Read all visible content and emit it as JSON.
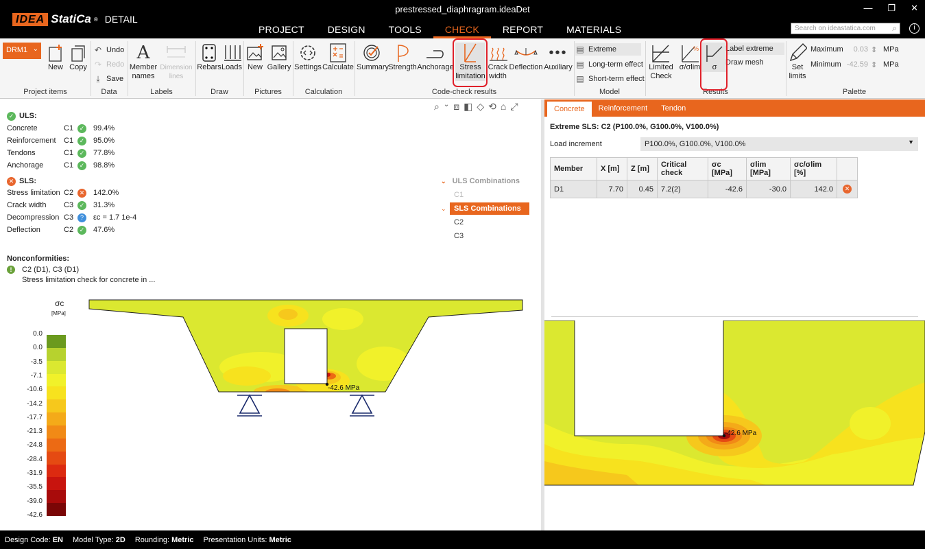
{
  "window": {
    "title": "prestressed_diaphragram.ideaDet",
    "logo_idea": "IDEA",
    "logo_statica": "StatiCa",
    "logo_reg": "®",
    "logo_product": "DETAIL",
    "controls": [
      "—",
      "❐",
      "✕"
    ]
  },
  "main_menu": [
    "PROJECT",
    "DESIGN",
    "TOOLS",
    "CHECK",
    "REPORT",
    "MATERIALS"
  ],
  "search": {
    "placeholder": "Search on ideastatica.com"
  },
  "ribbon": {
    "groups": {
      "project_items": "Project items",
      "data": "Data",
      "labels": "Labels",
      "draw": "Draw",
      "pictures": "Pictures",
      "calculation": "Calculation",
      "code_check": "Code-check results",
      "model": "Model",
      "results": "Results",
      "palette": "Palette"
    },
    "drm": "DRM1",
    "new": "New",
    "copy": "Copy",
    "undo": "Undo",
    "redo": "Redo",
    "save": "Save",
    "member_names_1": "Member",
    "member_names_2": "names",
    "dimension_lines_1": "Dimension",
    "dimension_lines_2": "lines",
    "rebars": "Rebars",
    "loads": "Loads",
    "pic_new": "New",
    "gallery": "Gallery",
    "settings": "Settings",
    "calculate": "Calculate",
    "summary": "Summary",
    "strength": "Strength",
    "anchorage": "Anchorage",
    "stress_1": "Stress",
    "stress_2": "limitation",
    "crack_1": "Crack",
    "crack_2": "width",
    "deflection": "Deflection",
    "auxiliary": "Auxiliary",
    "extreme": "Extreme",
    "long_term": "Long-term effect",
    "short_term": "Short-term effect",
    "limited_1": "Limited",
    "limited_2": "Check",
    "sigma_ratio": "σ/σlim",
    "sigma": "σ",
    "label_extreme": "Label extreme",
    "draw_mesh": "Draw mesh",
    "set_limits_1": "Set",
    "set_limits_2": "limits",
    "maximum": "Maximum",
    "minimum": "Minimum",
    "max_val": "0.03",
    "min_val": "-42.59",
    "unit": "MPa"
  },
  "summary": {
    "uls": "ULS:",
    "uls_rows": [
      {
        "name": "Concrete",
        "combo": "C1",
        "value": "99.4%"
      },
      {
        "name": "Reinforcement",
        "combo": "C1",
        "value": "95.0%"
      },
      {
        "name": "Tendons",
        "combo": "C1",
        "value": "77.8%"
      },
      {
        "name": "Anchorage",
        "combo": "C1",
        "value": "98.8%"
      }
    ],
    "sls": "SLS:",
    "sls_rows": [
      {
        "name": "Stress limitation",
        "combo": "C2",
        "value": "142.0%",
        "status": "bad"
      },
      {
        "name": "Crack width",
        "combo": "C3",
        "value": "31.3%",
        "status": "ok"
      },
      {
        "name": "Decompression",
        "combo": "C3",
        "value": "εc = 1.7 1e-4",
        "status": "info"
      },
      {
        "name": "Deflection",
        "combo": "C2",
        "value": "47.6%",
        "status": "ok"
      }
    ],
    "nonconf_title": "Nonconformities:",
    "nonconf_line1": "C2 (D1), C3 (D1)",
    "nonconf_line2": "Stress limitation check for concrete in ..."
  },
  "combinations": {
    "uls_header": "ULS Combinations",
    "uls_items": [
      "C1"
    ],
    "sls_header": "SLS Combinations",
    "sls_items": [
      "C2",
      "C3"
    ]
  },
  "legend": {
    "title": "σc",
    "unit": "[MPa]",
    "ticks": [
      "0.0",
      "0.0",
      "-3.5",
      "-7.1",
      "-10.6",
      "-14.2",
      "-17.7",
      "-21.3",
      "-24.8",
      "-28.4",
      "-31.9",
      "-35.5",
      "-39.0",
      "-42.6"
    ],
    "colors": [
      "#6b9a1e",
      "#b7d22e",
      "#dbe830",
      "#f1f12a",
      "#f7e21e",
      "#f6c81c",
      "#f4aa19",
      "#f18a16",
      "#ec6a14",
      "#e54a12",
      "#dc2a10",
      "#c8140e",
      "#a80b0b",
      "#7a0606"
    ]
  },
  "extreme_label": "-42.6 MPa",
  "detail": {
    "tabs": [
      "Concrete",
      "Reinforcement",
      "Tendon"
    ],
    "heading": "Extreme SLS: C2 (P100.0%, G100.0%, V100.0%)",
    "load_increment_label": "Load increment",
    "load_increment_value": "P100.0%, G100.0%, V100.0%",
    "table": {
      "headers": [
        "Member",
        "X [m]",
        "Z [m]",
        "Critical check",
        "σc [MPa]",
        "σlim [MPa]",
        "σc/σlim [%]",
        ""
      ],
      "rows": [
        [
          "D1",
          "7.70",
          "0.45",
          "7.2(2)",
          "-42.6",
          "-30.0",
          "142.0"
        ]
      ]
    },
    "extreme_label": "-42.6 MPa"
  },
  "status": {
    "design_code_label": "Design Code:",
    "design_code": "EN",
    "model_type_label": "Model Type:",
    "model_type": "2D",
    "rounding_label": "Rounding:",
    "rounding": "Metric",
    "units_label": "Presentation Units:",
    "units": "Metric"
  }
}
